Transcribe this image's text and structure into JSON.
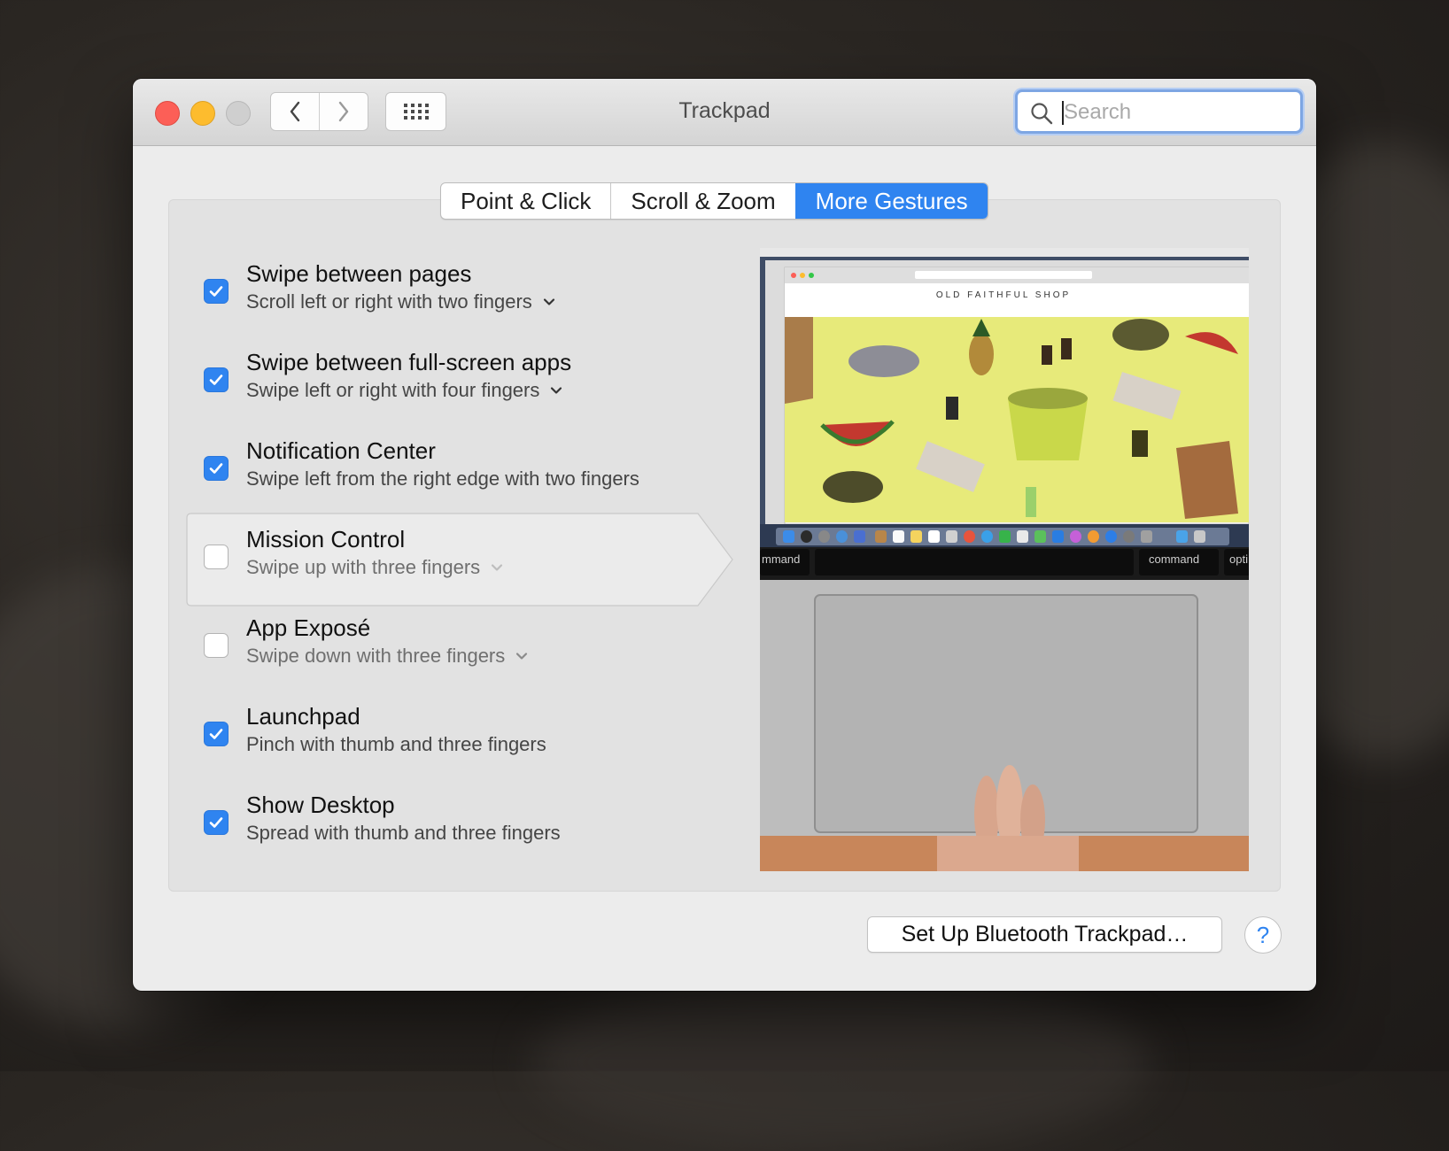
{
  "window": {
    "title": "Trackpad"
  },
  "toolbar": {
    "back_icon": "chevron-left-icon",
    "forward_icon": "chevron-right-icon",
    "show_all_icon": "grid-icon"
  },
  "search": {
    "placeholder": "Search",
    "value": "",
    "icon": "search-icon"
  },
  "tabs": [
    {
      "label": "Point & Click",
      "active": false
    },
    {
      "label": "Scroll & Zoom",
      "active": false
    },
    {
      "label": "More Gestures",
      "active": true
    }
  ],
  "gestures": [
    {
      "title": "Swipe between pages",
      "subtitle": "Scroll left or right with two fingers",
      "checked": true,
      "has_menu": true
    },
    {
      "title": "Swipe between full-screen apps",
      "subtitle": "Swipe left or right with four fingers",
      "checked": true,
      "has_menu": true
    },
    {
      "title": "Notification Center",
      "subtitle": "Swipe left from the right edge with two fingers",
      "checked": true,
      "has_menu": false
    },
    {
      "title": "Mission Control",
      "subtitle": "Swipe up with three fingers",
      "checked": false,
      "has_menu": true,
      "selected": true
    },
    {
      "title": "App Exposé",
      "subtitle": "Swipe down with three fingers",
      "checked": false,
      "has_menu": true
    },
    {
      "title": "Launchpad",
      "subtitle": "Pinch with thumb and three fingers",
      "checked": true,
      "has_menu": false
    },
    {
      "title": "Show Desktop",
      "subtitle": "Spread with thumb and three fingers",
      "checked": true,
      "has_menu": false
    }
  ],
  "preview": {
    "shop_name": "OLD FAITHFUL SHOP",
    "key_left": "mmand",
    "key_right": "command",
    "key_far_right": "opti"
  },
  "footer": {
    "bluetooth_label": "Set Up Bluetooth Trackpad…",
    "help_label": "?"
  },
  "colors": {
    "accent": "#2f84f0",
    "close": "#fc5f57",
    "minimize": "#fdbc2e",
    "zoom_disabled": "#cfcfcf"
  }
}
